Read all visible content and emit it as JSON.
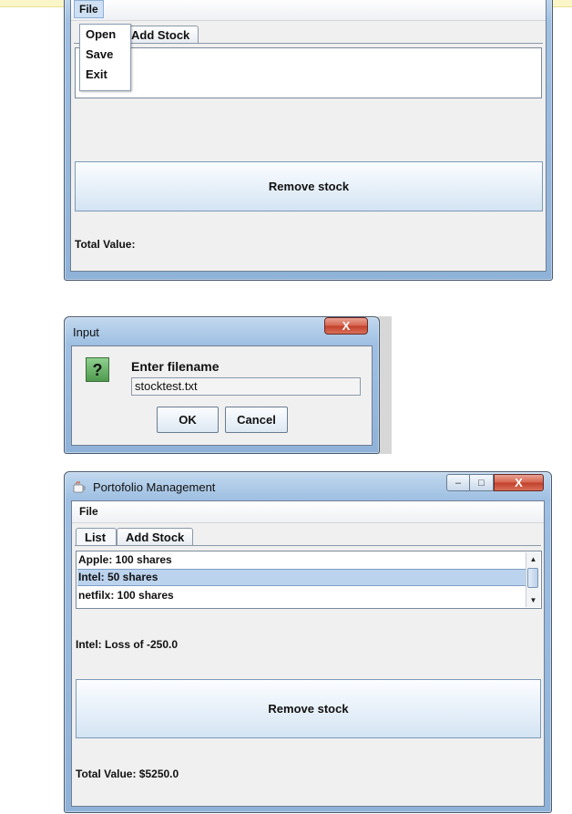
{
  "window1": {
    "menu_file": "File",
    "file_menu_items": [
      "Open",
      "Save",
      "Exit"
    ],
    "tab_add_stock": "Add Stock",
    "remove_button": "Remove stock",
    "total_value_label": "Total Value:"
  },
  "dialog": {
    "title": "Input",
    "close_label": "X",
    "question_icon": "?",
    "prompt": "Enter filename",
    "filename_value": "stocktest.txt",
    "ok_label": "OK",
    "cancel_label": "Cancel"
  },
  "window3": {
    "title": "Portofolio Management",
    "menu_file": "File",
    "tabs": [
      "List",
      "Add Stock"
    ],
    "stocks": [
      "Apple: 100 shares",
      "Intel: 50 shares",
      "netfilx: 100 shares"
    ],
    "selected_index": 1,
    "status": "Intel: Loss of -250.0",
    "remove_button": "Remove stock",
    "total_value": "Total Value: $5250.0",
    "window_buttons": {
      "minimize": "–",
      "maximize": "□",
      "close": "X"
    }
  },
  "colors": {
    "title_gradient": "#9fc0e3",
    "selection": "#bcd3ee",
    "close_button": "#d6654f",
    "question_icon": "#4e9a4e"
  }
}
